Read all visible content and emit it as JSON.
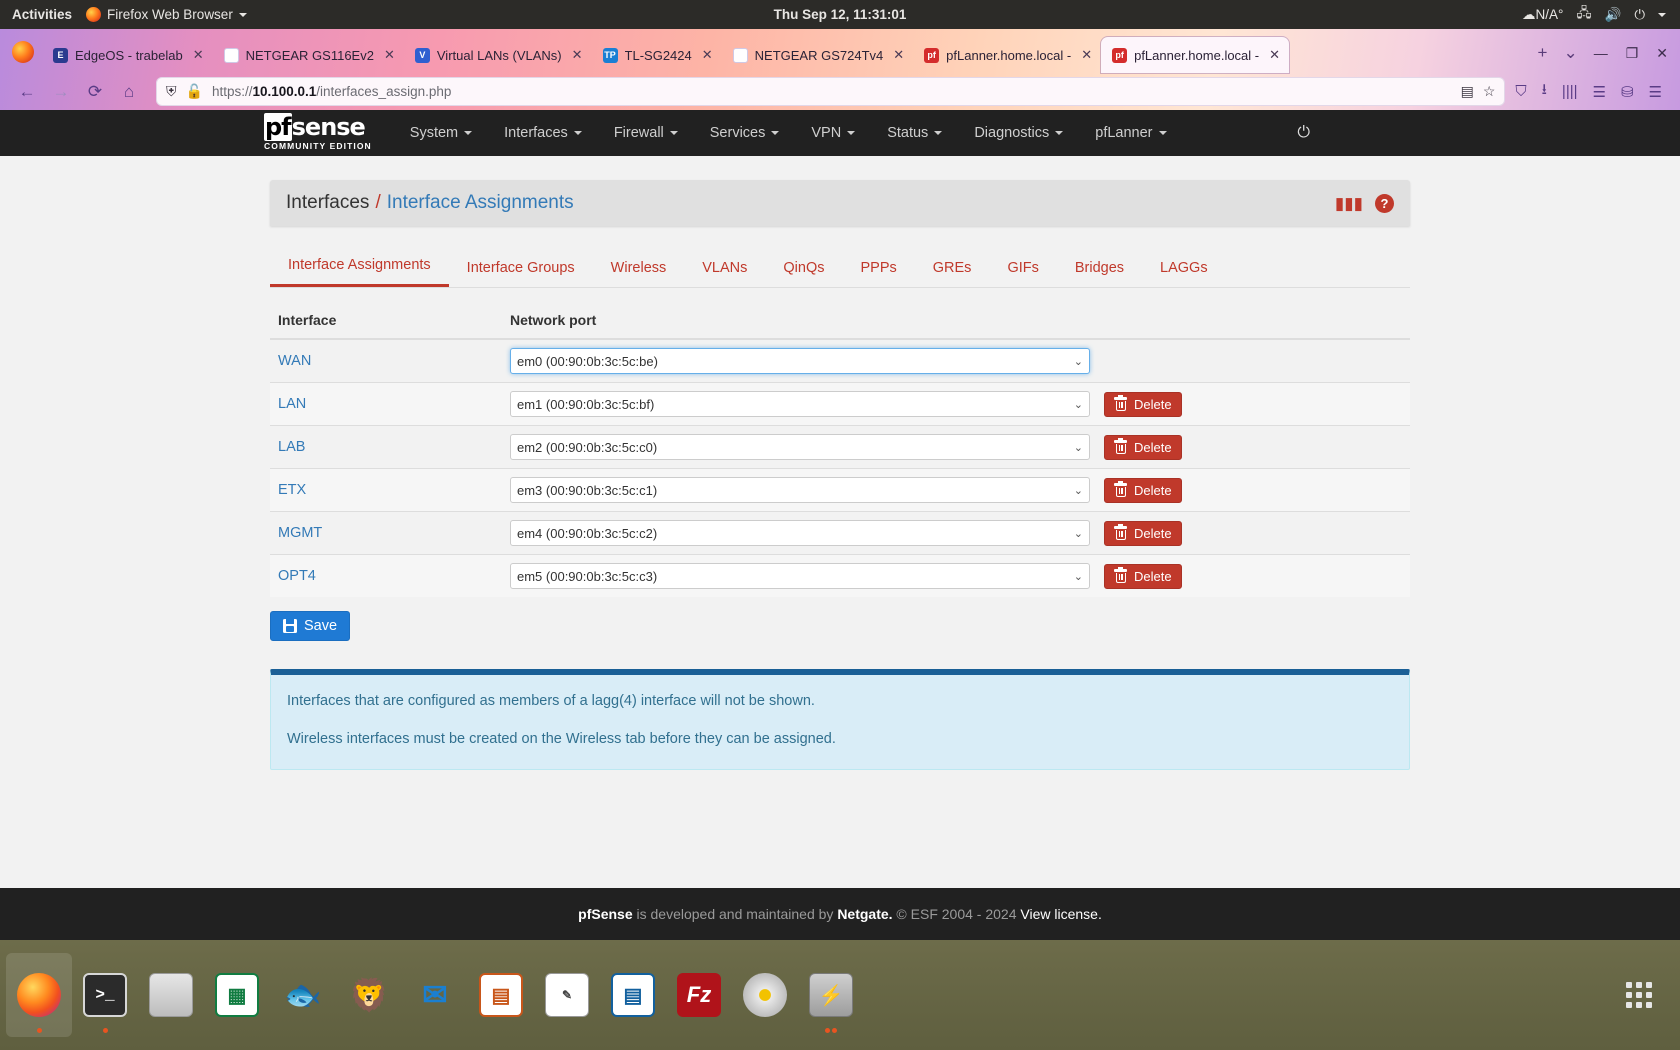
{
  "desktop": {
    "activities": "Activities",
    "app_menu": "Firefox Web Browser",
    "clock": "Thu Sep 12, 11:31:01",
    "temperature": "N/A°"
  },
  "browser": {
    "tabs": [
      {
        "title": "EdgeOS - trabelab",
        "favicon": "edgeos-icon",
        "active": false
      },
      {
        "title": "NETGEAR GS116Ev2",
        "favicon": "netgear-icon",
        "active": false
      },
      {
        "title": "Virtual LANs (VLANs)",
        "favicon": "vlan-icon",
        "active": false
      },
      {
        "title": "TL-SG2424",
        "favicon": "tplink-icon",
        "active": false
      },
      {
        "title": "NETGEAR GS724Tv4",
        "favicon": "netgear-icon",
        "active": false
      },
      {
        "title": "pfLanner.home.local -",
        "favicon": "pfsense-icon",
        "active": false
      },
      {
        "title": "pfLanner.home.local -",
        "favicon": "pfsense-icon",
        "active": true
      }
    ],
    "new_tab_label": "+",
    "list_all_tabs_label": "⌄",
    "url": {
      "scheme": "https://",
      "host": "10.100.0.1",
      "path": "/interfaces_assign.php"
    },
    "window_controls": {
      "minimize": "—",
      "restore": "❐",
      "close": "✕"
    }
  },
  "pfsense_nav": {
    "brand": "sense",
    "brand_prefix": "pf",
    "brand_sub": "COMMUNITY EDITION",
    "items": [
      {
        "label": "System"
      },
      {
        "label": "Interfaces"
      },
      {
        "label": "Firewall"
      },
      {
        "label": "Services"
      },
      {
        "label": "VPN"
      },
      {
        "label": "Status"
      },
      {
        "label": "Diagnostics"
      },
      {
        "label": "pfLanner"
      }
    ]
  },
  "breadcrumb": {
    "root": "Interfaces",
    "separator": "/",
    "current": "Interface Assignments"
  },
  "page_tabs": [
    {
      "label": "Interface Assignments",
      "active": true
    },
    {
      "label": "Interface Groups",
      "active": false
    },
    {
      "label": "Wireless",
      "active": false
    },
    {
      "label": "VLANs",
      "active": false
    },
    {
      "label": "QinQs",
      "active": false
    },
    {
      "label": "PPPs",
      "active": false
    },
    {
      "label": "GREs",
      "active": false
    },
    {
      "label": "GIFs",
      "active": false
    },
    {
      "label": "Bridges",
      "active": false
    },
    {
      "label": "LAGGs",
      "active": false
    }
  ],
  "table": {
    "headers": [
      "Interface",
      "Network port"
    ],
    "rows": [
      {
        "interface": "WAN",
        "port": "em0 (00:90:0b:3c:5c:be)",
        "focused": true,
        "delete": null
      },
      {
        "interface": "LAN",
        "port": "em1 (00:90:0b:3c:5c:bf)",
        "focused": false,
        "delete": "Delete"
      },
      {
        "interface": "LAB",
        "port": "em2 (00:90:0b:3c:5c:c0)",
        "focused": false,
        "delete": "Delete"
      },
      {
        "interface": "ETX",
        "port": "em3 (00:90:0b:3c:5c:c1)",
        "focused": false,
        "delete": "Delete"
      },
      {
        "interface": "MGMT",
        "port": "em4 (00:90:0b:3c:5c:c2)",
        "focused": false,
        "delete": "Delete"
      },
      {
        "interface": "OPT4",
        "port": "em5 (00:90:0b:3c:5c:c3)",
        "focused": false,
        "delete": "Delete"
      }
    ]
  },
  "save_label": "Save",
  "info": {
    "line1": "Interfaces that are configured as members of a lagg(4) interface will not be shown.",
    "line2": "Wireless interfaces must be created on the Wireless tab before they can be assigned."
  },
  "footer": {
    "brand": "pfSense",
    "text1": " is developed and maintained by ",
    "netgate": "Netgate.",
    "text2": " © ESF 2004 - 2024 ",
    "license": "View license."
  },
  "dock": [
    {
      "name": "firefox",
      "glyph": "",
      "running": true,
      "dots": 1
    },
    {
      "name": "terminal",
      "glyph": ">_",
      "running": false,
      "dots": 1
    },
    {
      "name": "files",
      "glyph": "",
      "running": false,
      "dots": 0
    },
    {
      "name": "calc",
      "glyph": "▦",
      "running": false,
      "dots": 0
    },
    {
      "name": "fish-browser",
      "glyph": "🐟",
      "running": false,
      "dots": 0
    },
    {
      "name": "brave",
      "glyph": "🦁",
      "running": false,
      "dots": 0
    },
    {
      "name": "thunderbird",
      "glyph": "✉",
      "running": false,
      "dots": 0
    },
    {
      "name": "impress",
      "glyph": "▤",
      "running": false,
      "dots": 0
    },
    {
      "name": "draw",
      "glyph": "✎",
      "running": false,
      "dots": 0
    },
    {
      "name": "writer",
      "glyph": "▤",
      "running": false,
      "dots": 0
    },
    {
      "name": "filezilla",
      "glyph": "Fz",
      "running": false,
      "dots": 0
    },
    {
      "name": "disc-burner",
      "glyph": "",
      "running": false,
      "dots": 0
    },
    {
      "name": "remmina",
      "glyph": "⚡",
      "running": false,
      "dots": 2
    }
  ],
  "colors": {
    "accent_red": "#c0392b",
    "link_blue": "#337ab7",
    "save_blue": "#1f7ad4",
    "info_bg": "#d9edf7",
    "nav_dark": "#212121"
  }
}
